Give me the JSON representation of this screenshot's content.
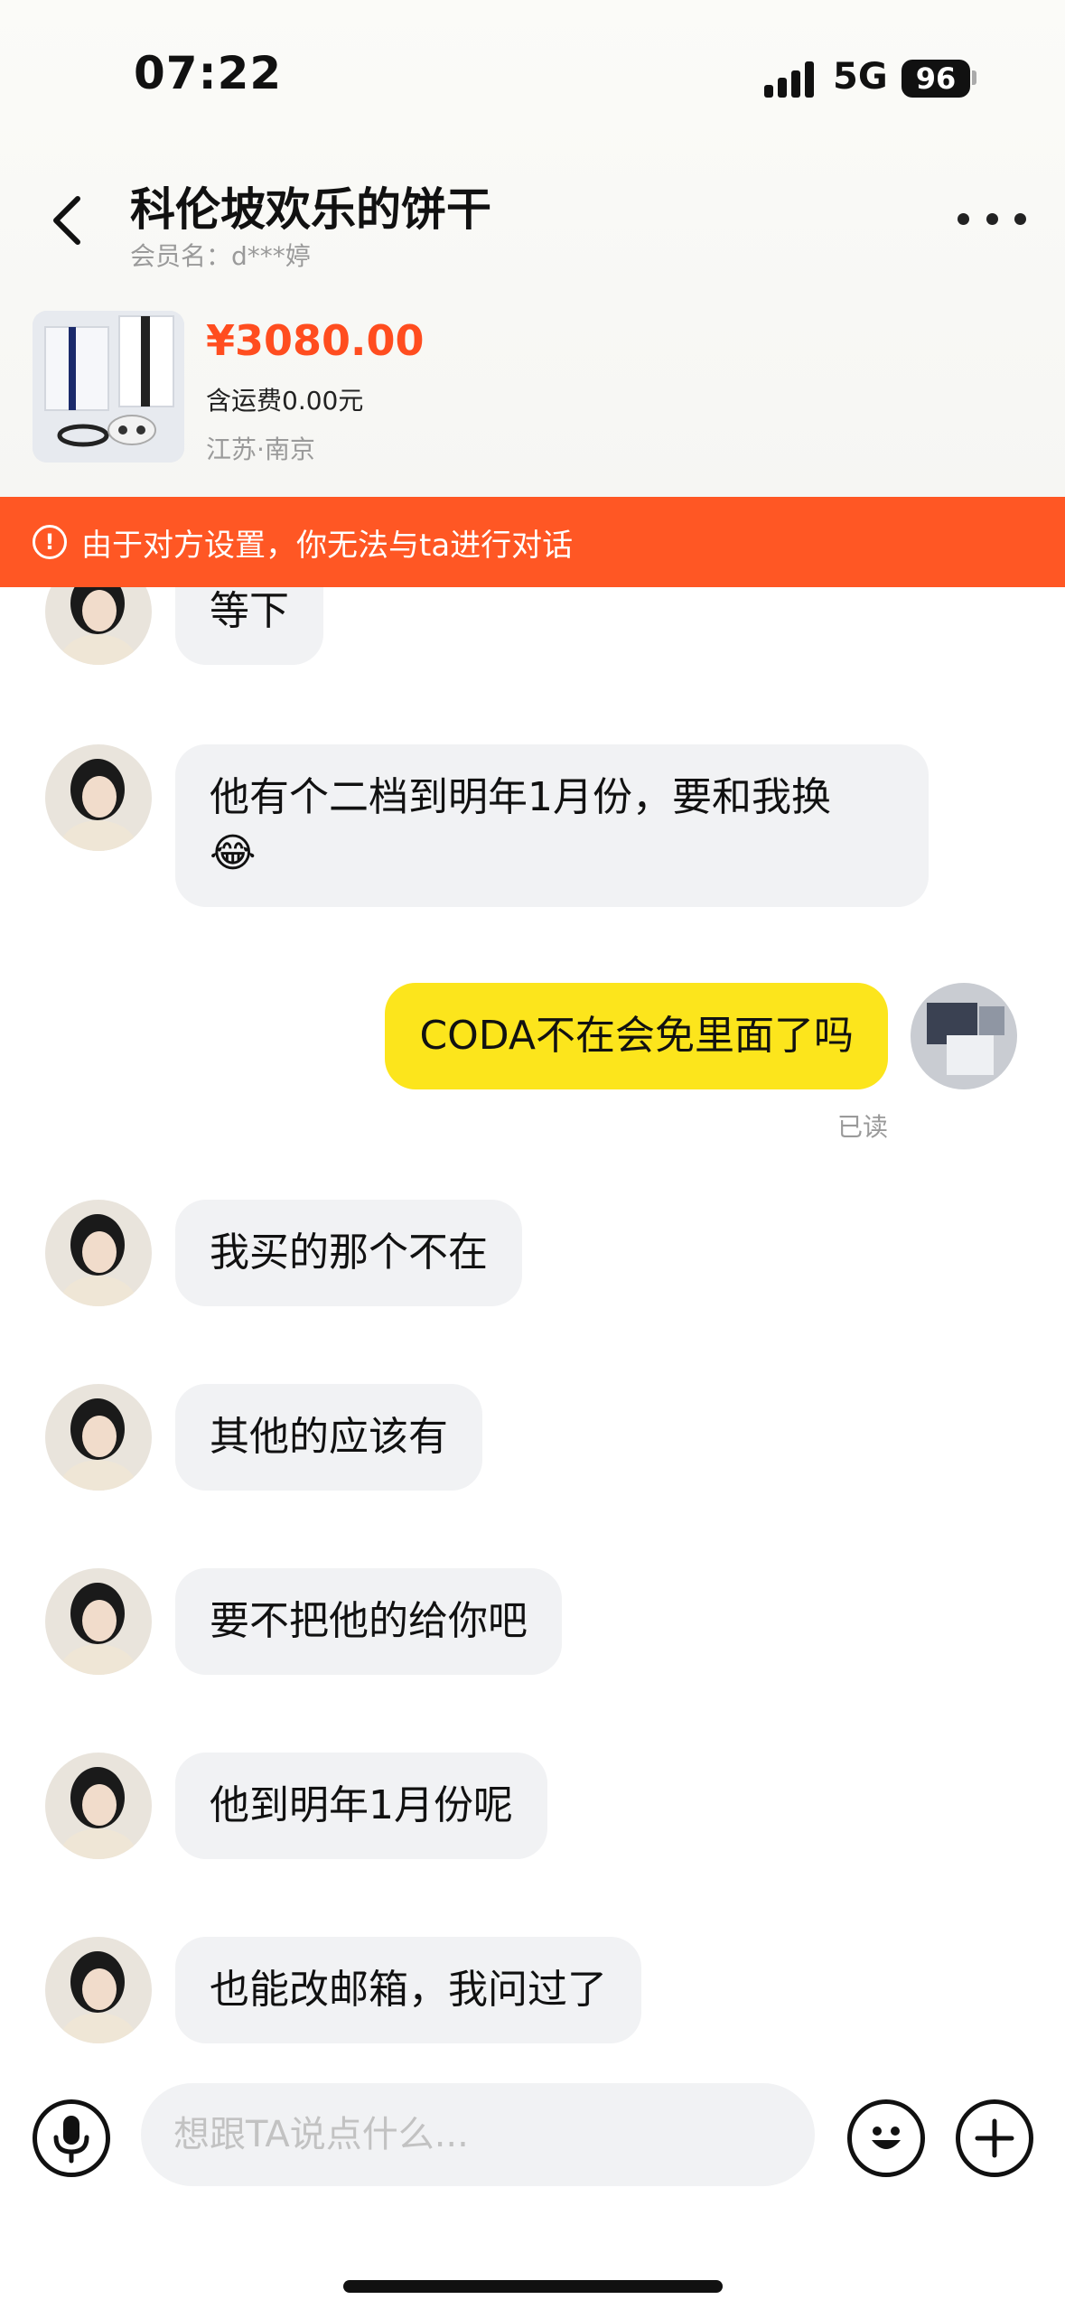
{
  "status_bar": {
    "time": "07:22",
    "network": "5G",
    "battery": "96"
  },
  "header": {
    "title": "科伦坡欢乐的饼干",
    "subtitle": "会员名：d***婷",
    "icons": {
      "back": "chevron-left-icon",
      "more": "more-horizontal-icon"
    }
  },
  "product": {
    "price": "¥3080.00",
    "shipping": "含运费0.00元",
    "location": "江苏·南京"
  },
  "banner": {
    "icon": "alert-circle-icon",
    "text": "由于对方设置，你无法与ta进行对话",
    "color": "#ff5724"
  },
  "messages": [
    {
      "from": "other",
      "text": "等下"
    },
    {
      "from": "other",
      "text": "他有个二档到明年1月份，要和我换",
      "emoji": "😂"
    },
    {
      "from": "me",
      "text": "CODA不在会免里面了吗",
      "status": "已读"
    },
    {
      "from": "other",
      "text": "我买的那个不在"
    },
    {
      "from": "other",
      "text": "其他的应该有"
    },
    {
      "from": "other",
      "text": "要不把他的给你吧"
    },
    {
      "from": "other",
      "text": "他到明年1月份呢"
    },
    {
      "from": "other",
      "text": "也能改邮箱，我问过了"
    }
  ],
  "input": {
    "placeholder": "想跟TA说点什么...",
    "icons": {
      "voice": "microphone-icon",
      "emoji": "emoji-icon",
      "plus": "plus-icon"
    }
  },
  "colors": {
    "accent": "#ff4d1f",
    "my_bubble": "#fce51c",
    "other_bubble": "#f1f2f4"
  }
}
